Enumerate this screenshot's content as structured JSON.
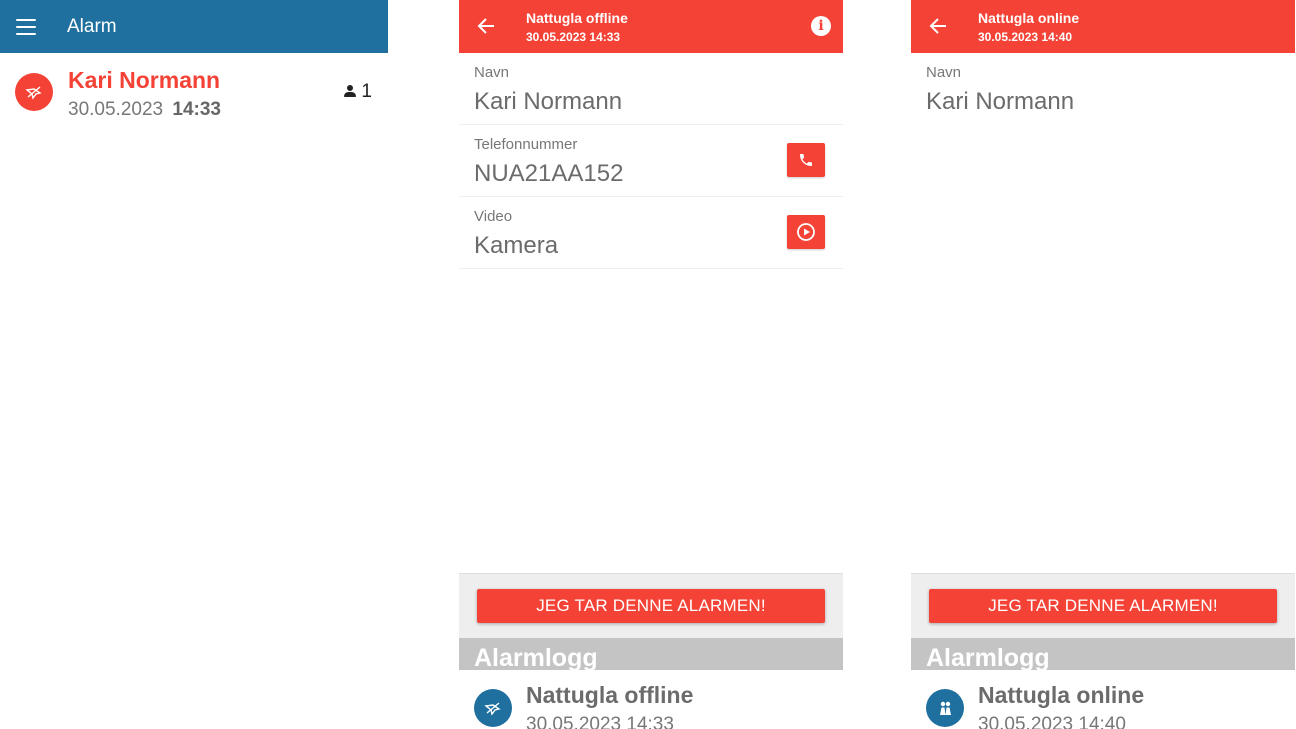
{
  "screen_list": {
    "title": "Alarm",
    "item": {
      "name": "Kari Normann",
      "date": "30.05.2023",
      "time": "14:33",
      "count": "1",
      "icon": "bird-offline-icon"
    }
  },
  "screen_offline": {
    "title": "Nattugla offline",
    "subtitle": "30.05.2023 14:33",
    "fields": [
      {
        "label": "Navn",
        "value": "Kari Normann"
      },
      {
        "label": "Telefonnummer",
        "value": "NUA21AA152",
        "action_icon": "phone-icon"
      },
      {
        "label": "Video",
        "value": "Kamera",
        "action_icon": "play-icon"
      }
    ],
    "button": "JEG TAR DENNE ALARMEN!",
    "log_title": "Alarmlogg",
    "log": {
      "event": "Nattugla offline",
      "time": "30.05.2023 14:33",
      "icon": "bird-offline-icon"
    }
  },
  "screen_online": {
    "title": "Nattugla online",
    "subtitle": "30.05.2023 14:40",
    "fields": [
      {
        "label": "Navn",
        "value": "Kari Normann"
      }
    ],
    "button": "JEG TAR DENNE ALARMEN!",
    "log_title": "Alarmlogg",
    "log": {
      "event": "Nattugla online",
      "time": "30.05.2023 14:40",
      "icon": "owl-online-icon"
    }
  },
  "colors": {
    "primary_blue": "#1f6f9f",
    "alarm_red": "#f44336",
    "log_header_gray": "#c4c4c4"
  }
}
